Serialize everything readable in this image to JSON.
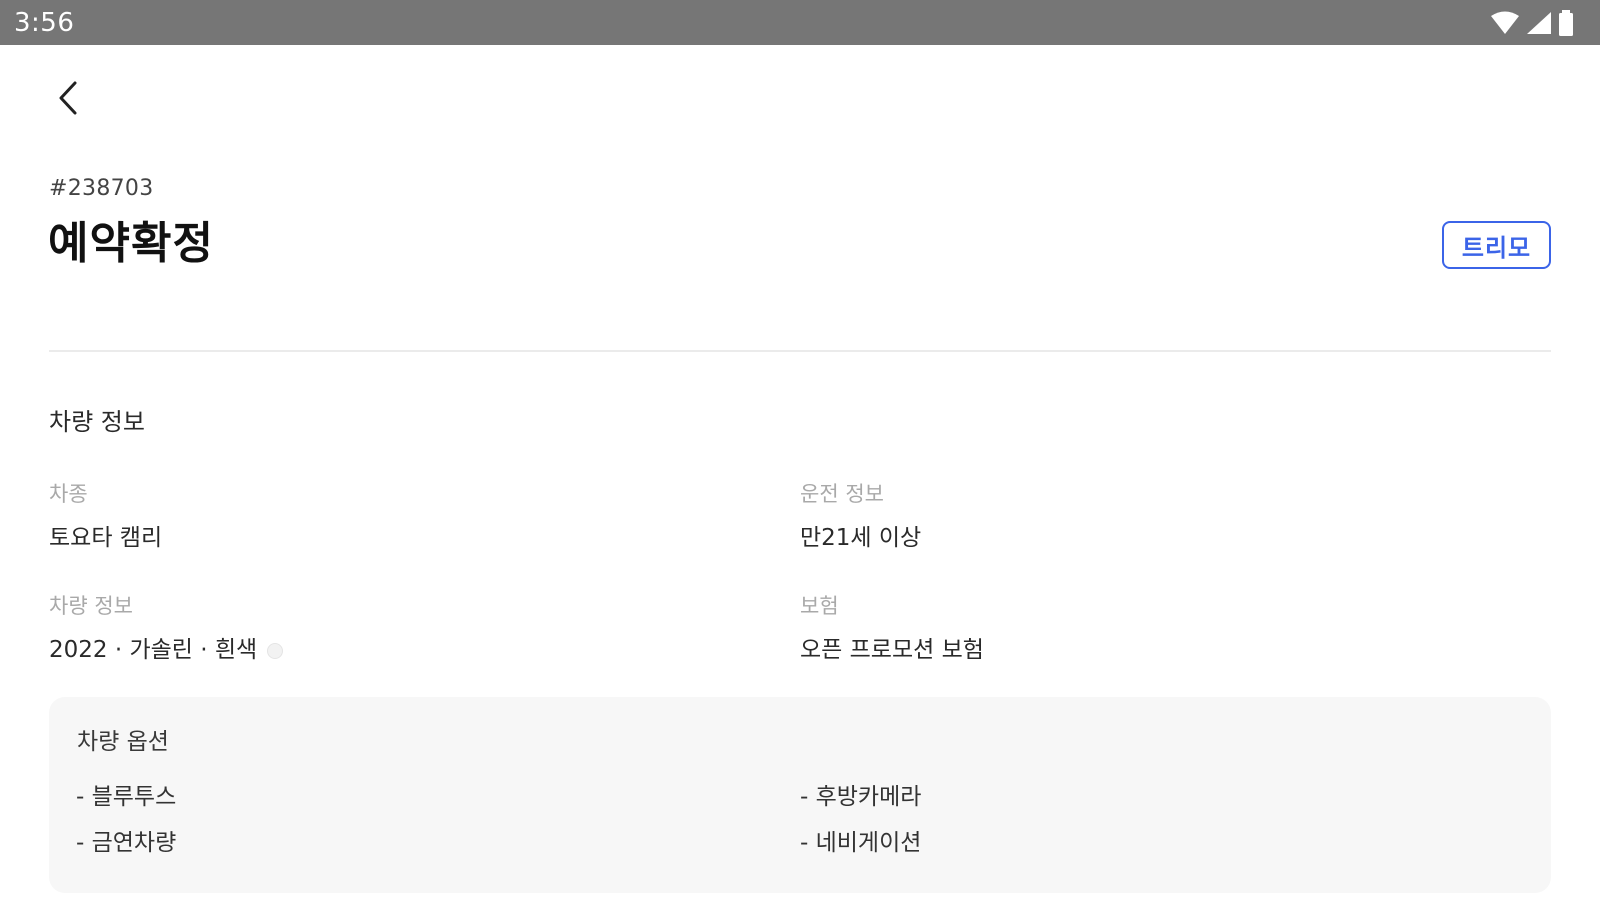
{
  "status_bar": {
    "time": "3:56",
    "icons": [
      "wifi-icon",
      "cellular-signal-icon",
      "battery-icon"
    ]
  },
  "nav": {
    "back_icon": "chevron-left-icon"
  },
  "reservation": {
    "number": "#238703",
    "status_title": "예약확정",
    "brand_badge": "트리모"
  },
  "vehicle_info": {
    "section_title": "차량 정보",
    "fields": [
      {
        "label": "차종",
        "value": "토요타 캠리"
      },
      {
        "label": "운전 정보",
        "value": "만21세 이상"
      },
      {
        "label": "차량 정보",
        "value": "2022 · 가솔린 · 흰색"
      },
      {
        "label": "보험",
        "value": "오픈 프로모션 보험"
      }
    ],
    "color_swatch": "#f2f2f2"
  },
  "vehicle_options": {
    "title": "차량 옵션",
    "items": [
      "- 블루투스",
      "- 후방카메라",
      "- 금연차량",
      "- 네비게이션"
    ]
  },
  "colors": {
    "status_bar": "#767676",
    "accent": "#3b64e8",
    "card_bg": "#f7f7f7"
  }
}
